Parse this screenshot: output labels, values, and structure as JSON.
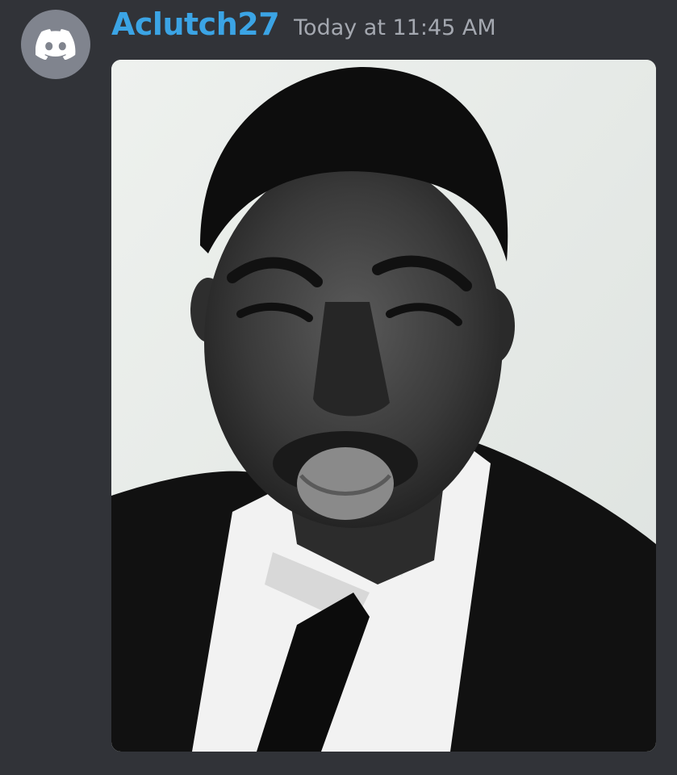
{
  "message": {
    "author": {
      "username": "Aclutch27",
      "avatar_icon": "discord-logo-icon",
      "avatar_color": "#80848e",
      "username_color": "#3ba4e5"
    },
    "timestamp": "Today at 11:45 AM",
    "attachment": {
      "type": "image",
      "subject": "man in black suit and tie with white shirt, grayscale"
    }
  },
  "theme": {
    "background": "#313338",
    "timestamp_color": "#a4a8b0"
  }
}
